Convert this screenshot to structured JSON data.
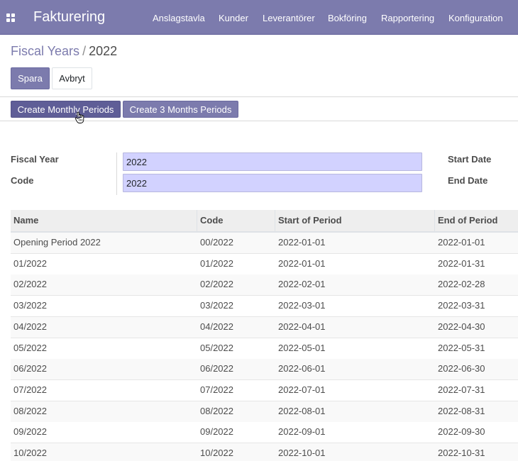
{
  "navbar": {
    "brand": "Fakturering",
    "menu": [
      "Anslagstavla",
      "Kunder",
      "Leverantörer",
      "Bokföring",
      "Rapportering",
      "Konfiguration"
    ]
  },
  "breadcrumb": {
    "parent": "Fiscal Years",
    "separator": "/",
    "current": "2022"
  },
  "actions": {
    "save": "Spara",
    "cancel": "Avbryt"
  },
  "header_buttons": {
    "monthly": "Create Monthly Periods",
    "three_months": "Create 3 Months Periods"
  },
  "form": {
    "fiscal_year_label": "Fiscal Year",
    "fiscal_year_value": "2022",
    "code_label": "Code",
    "code_value": "2022",
    "start_date_label": "Start Date",
    "end_date_label": "End Date"
  },
  "periods": {
    "columns": [
      "Name",
      "Code",
      "Start of Period",
      "End of Period"
    ],
    "rows": [
      [
        "Opening Period 2022",
        "00/2022",
        "2022-01-01",
        "2022-01-01"
      ],
      [
        "01/2022",
        "01/2022",
        "2022-01-01",
        "2022-01-31"
      ],
      [
        "02/2022",
        "02/2022",
        "2022-02-01",
        "2022-02-28"
      ],
      [
        "03/2022",
        "03/2022",
        "2022-03-01",
        "2022-03-31"
      ],
      [
        "04/2022",
        "04/2022",
        "2022-04-01",
        "2022-04-30"
      ],
      [
        "05/2022",
        "05/2022",
        "2022-05-01",
        "2022-05-31"
      ],
      [
        "06/2022",
        "06/2022",
        "2022-06-01",
        "2022-06-30"
      ],
      [
        "07/2022",
        "07/2022",
        "2022-07-01",
        "2022-07-31"
      ],
      [
        "08/2022",
        "08/2022",
        "2022-08-01",
        "2022-08-31"
      ],
      [
        "09/2022",
        "09/2022",
        "2022-09-01",
        "2022-09-30"
      ],
      [
        "10/2022",
        "10/2022",
        "2022-10-01",
        "2022-10-31"
      ]
    ]
  },
  "colors": {
    "brand": "#7c7bad",
    "brand_dark": "#5f5e97",
    "input_required": "#d2d2ff"
  }
}
